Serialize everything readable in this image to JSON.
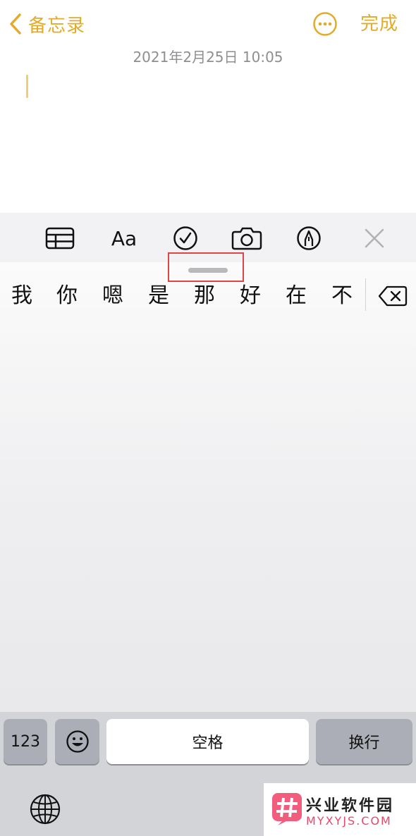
{
  "nav": {
    "back_label": "备忘录",
    "more_icon": "ellipsis-circle-icon",
    "done_label": "完成",
    "accent_color": "#E2AB2A"
  },
  "note": {
    "date": "2021年2月25日 10:05"
  },
  "toolbar": {
    "items": [
      "table-icon",
      "text-format-icon",
      "checklist-icon",
      "camera-icon",
      "markup-pen-icon",
      "close-icon"
    ],
    "format_label": "Aa"
  },
  "keyboard": {
    "candidates": [
      "我",
      "你",
      "嗯",
      "是",
      "那",
      "好",
      "在",
      "不"
    ],
    "delete_icon": "backspace-icon",
    "keys": {
      "numbers": "123",
      "emoji_icon": "emoji-icon",
      "space": "空格",
      "return": "换行",
      "globe_icon": "globe-icon"
    }
  },
  "watermark": {
    "title": "兴业软件园",
    "subtitle": "MYXYJS.COM"
  }
}
